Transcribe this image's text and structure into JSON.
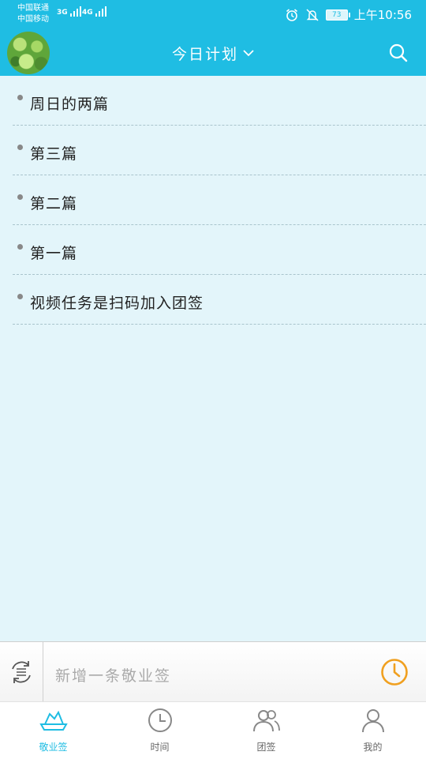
{
  "status": {
    "carrier1": "中国联通",
    "carrier2": "中国移动",
    "net1": "3G",
    "net2": "4G",
    "battery": "73",
    "time": "上午10:56"
  },
  "header": {
    "title": "今日计划"
  },
  "list": {
    "items": [
      {
        "text": "周日的两篇"
      },
      {
        "text": "第三篇"
      },
      {
        "text": "第二篇"
      },
      {
        "text": "第一篇"
      },
      {
        "text": "视频任务是扫码加入团签"
      }
    ]
  },
  "input": {
    "placeholder": "新增一条敬业签"
  },
  "tabs": [
    {
      "label": "敬业签",
      "icon": "boat-icon"
    },
    {
      "label": "时间",
      "icon": "clock-icon"
    },
    {
      "label": "团签",
      "icon": "group-icon"
    },
    {
      "label": "我的",
      "icon": "person-icon"
    }
  ],
  "colors": {
    "accent": "#1fbde3",
    "background": "#e3f5fa",
    "clock_orange": "#f0a020"
  }
}
